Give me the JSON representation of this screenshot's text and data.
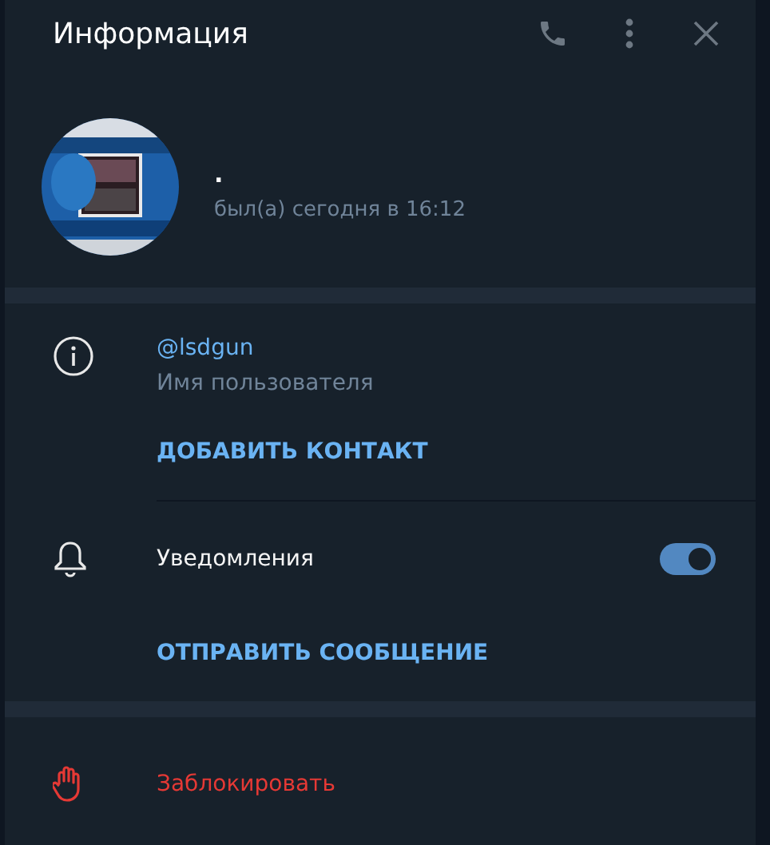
{
  "header": {
    "title": "Информация"
  },
  "profile": {
    "name": ".",
    "status": "был(а) сегодня в 16:12"
  },
  "info": {
    "username": "@lsdgun",
    "username_label": "Имя пользователя",
    "action": "ДОБАВИТЬ КОНТАКТ"
  },
  "notifications": {
    "label": "Уведомления",
    "on": true,
    "action": "ОТПРАВИТЬ СООБЩЕНИЕ"
  },
  "block": {
    "label": "Заблокировать"
  }
}
